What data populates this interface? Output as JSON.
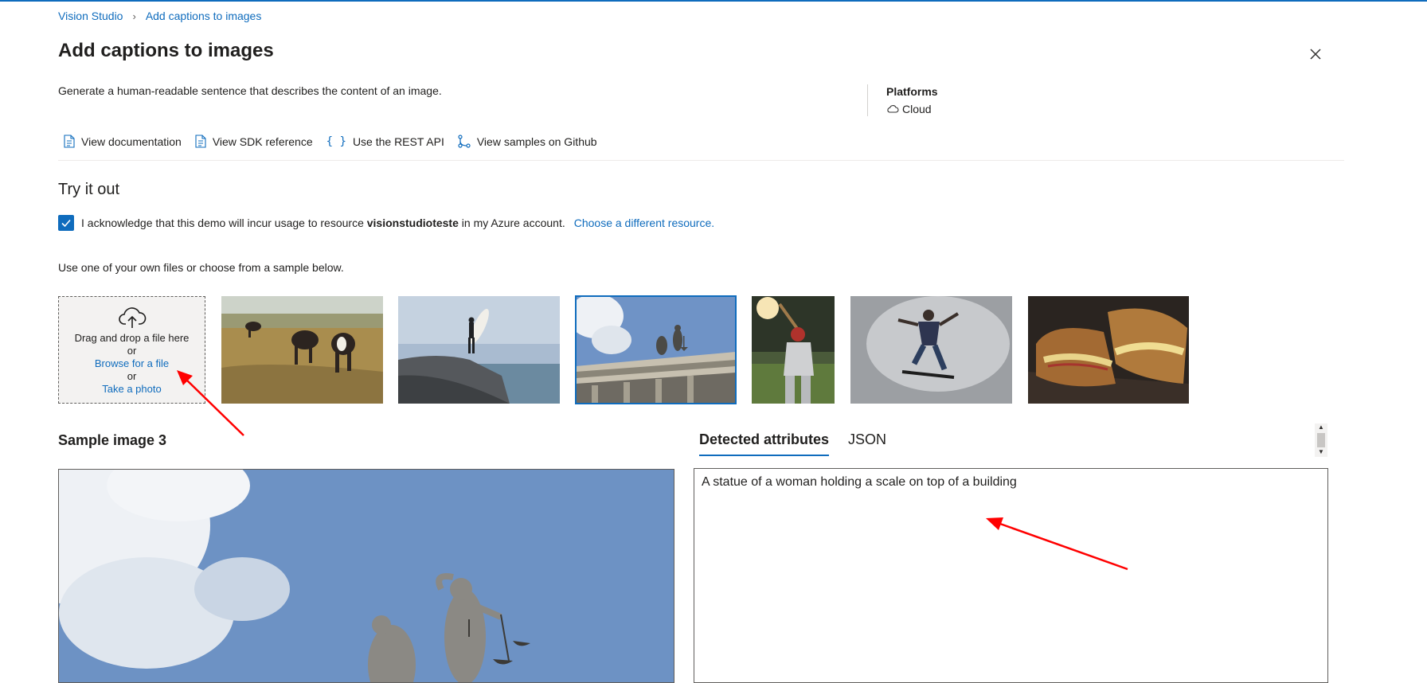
{
  "breadcrumb": {
    "home": "Vision Studio",
    "current": "Add captions to images"
  },
  "page": {
    "title": "Add captions to images",
    "description": "Generate a human-readable sentence that describes the content of an image."
  },
  "platforms": {
    "title": "Platforms",
    "value": "Cloud"
  },
  "resource_links": [
    {
      "label": "View documentation",
      "icon": "document-icon"
    },
    {
      "label": "View SDK reference",
      "icon": "document-icon"
    },
    {
      "label": "Use the REST API",
      "icon": "braces-icon"
    },
    {
      "label": "View samples on Github",
      "icon": "branch-icon"
    }
  ],
  "try_it": {
    "title": "Try it out",
    "ack_prefix": "I acknowledge that this demo will incur usage to resource",
    "resource_name": "visionstudioteste",
    "ack_suffix": "in my Azure account.",
    "choose_link": "Choose a different resource.",
    "ack_checked": true
  },
  "files": {
    "instruction": "Use one of your own files or choose from a sample below.",
    "drop_text": "Drag and drop a file here",
    "or1": "or",
    "browse_link": "Browse for a file",
    "or2": "or",
    "photo_link": "Take a photo"
  },
  "samples": [
    {
      "name": "cows-grazing",
      "selected": false
    },
    {
      "name": "surfer-on-rock",
      "selected": false
    },
    {
      "name": "statue-on-building",
      "selected": true
    },
    {
      "name": "baseball-batter",
      "selected": false
    },
    {
      "name": "skateboarder",
      "selected": false
    },
    {
      "name": "grilled-sandwich",
      "selected": false
    }
  ],
  "preview": {
    "title": "Sample image 3"
  },
  "tabs": [
    {
      "label": "Detected attributes",
      "active": true
    },
    {
      "label": "JSON",
      "active": false
    }
  ],
  "result": {
    "caption": "A statue of a woman holding a scale on top of a building"
  },
  "colors": {
    "accent": "#0f6cbd",
    "annotation_arrow": "#ff0000"
  }
}
